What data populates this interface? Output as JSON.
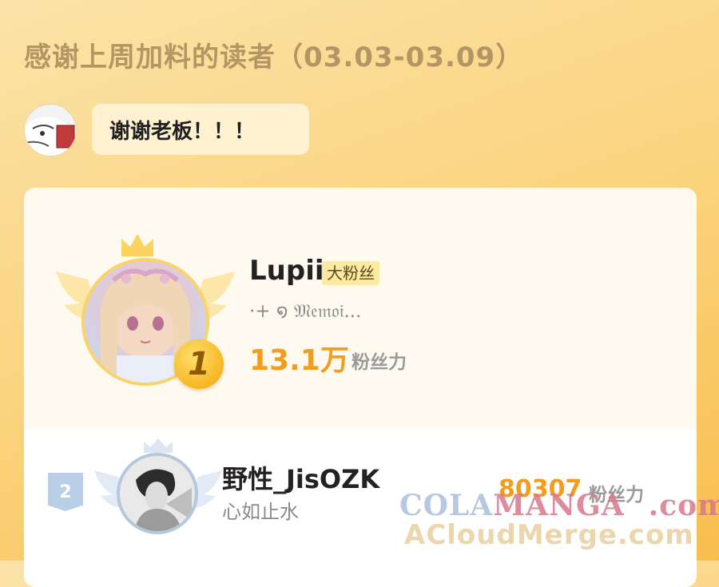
{
  "header": {
    "title": "感谢上周加料的读者（03.03-03.09）"
  },
  "thanks": {
    "message": "谢谢老板！！！"
  },
  "leaderboard": {
    "first": {
      "rank": "1",
      "name": "Lupii",
      "badge": "大粉丝",
      "motto": "·+ ໑ 𝔐𝔢𝔪𝔬𝔦...",
      "score": "13.1万",
      "score_unit": "粉丝力"
    },
    "second": {
      "rank": "2",
      "name": "野性_JisOZK",
      "motto": "心如止水",
      "score": "80307",
      "score_unit": "粉丝力"
    }
  },
  "watermark": {
    "line1_a": "COLA",
    "line1_b": "MANGA",
    "line1_c": ".com",
    "line2": "ACloudMerge.com"
  },
  "colors": {
    "accent": "#f39d1e",
    "gold": "#fcd26a",
    "silver": "#b5c8de"
  }
}
